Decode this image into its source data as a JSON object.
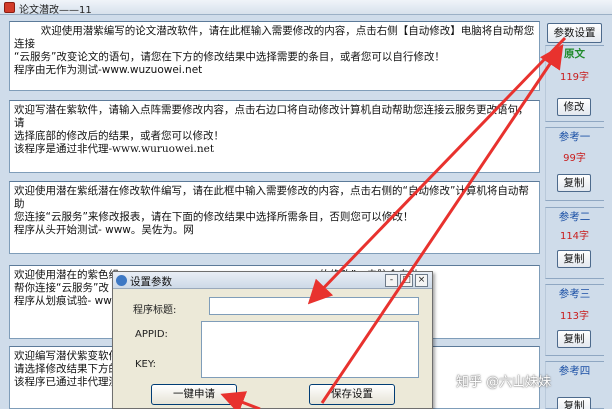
{
  "window": {
    "title": "论文潜改——11"
  },
  "textboxes": [
    "        欢迎使用潜紫编写的论文潜改软件，请在此框输入需要修改的内容，点击右侧【自动修改】电脑将自动帮您连接\n“云服务”改变论文的语句，请您在下方的修改结果中选择需要的条目，或者您可以自行修改！\n程序由无作为测试-www.wuzuowei.net",
    "欢迎写潜在紫软件，请输入点阵需要修改内容，点击右边口将自动修改计算机自动帮助您连接云服务更改语句，请\n选择底部的修改后的结果，或者您可以修改！\n该程序是通过非代理-www.wuruowei.net",
    "欢迎使用潜在紫纸潜在修改软件编写，请在此框中输入需要修改的内容，点击右侧的“自动修改”计算机将自动帮助\n您连接“云服务”来修改报表，请在下面的修改结果中选择所需条目，否则您可以修改！\n程序从头开始测试- www。吴佐为。网",
    "欢迎使用潜在的紫色组                                                            的修改”，电脑会自动\n帮你连接“云服务”改\n程序从划痕试验- www",
    "欢迎编写潜伏紫变软件                                                            接云服务修改语句，\n请选择修改结果下方的\n该程序已通过非代理测"
  ],
  "side_panel": {
    "settings_button": "参数设置",
    "original": {
      "label": "原文",
      "count": "119字",
      "button": "修改"
    },
    "refs": [
      {
        "label": "参考一",
        "count": "99字",
        "button": "复制"
      },
      {
        "label": "参考二",
        "count": "114字",
        "button": "复制"
      },
      {
        "label": "参考三",
        "count": "113字",
        "button": "复制"
      },
      {
        "label": "参考四",
        "count": "",
        "button": "复制"
      }
    ]
  },
  "dialog": {
    "title": "设置参数",
    "buttons": {
      "min": "-",
      "max": "□",
      "close": "×"
    },
    "fields": {
      "title_label": "程序标题:",
      "appid_label": "APPID:",
      "key_label": "KEY:"
    },
    "apply_button": "一键申请",
    "save_button": "保存设置"
  },
  "watermark": "知乎 @六山妹妹",
  "colors": {
    "arrow": "#e8322e",
    "accent": "#1a4fa5",
    "count": "#c91c1c"
  }
}
